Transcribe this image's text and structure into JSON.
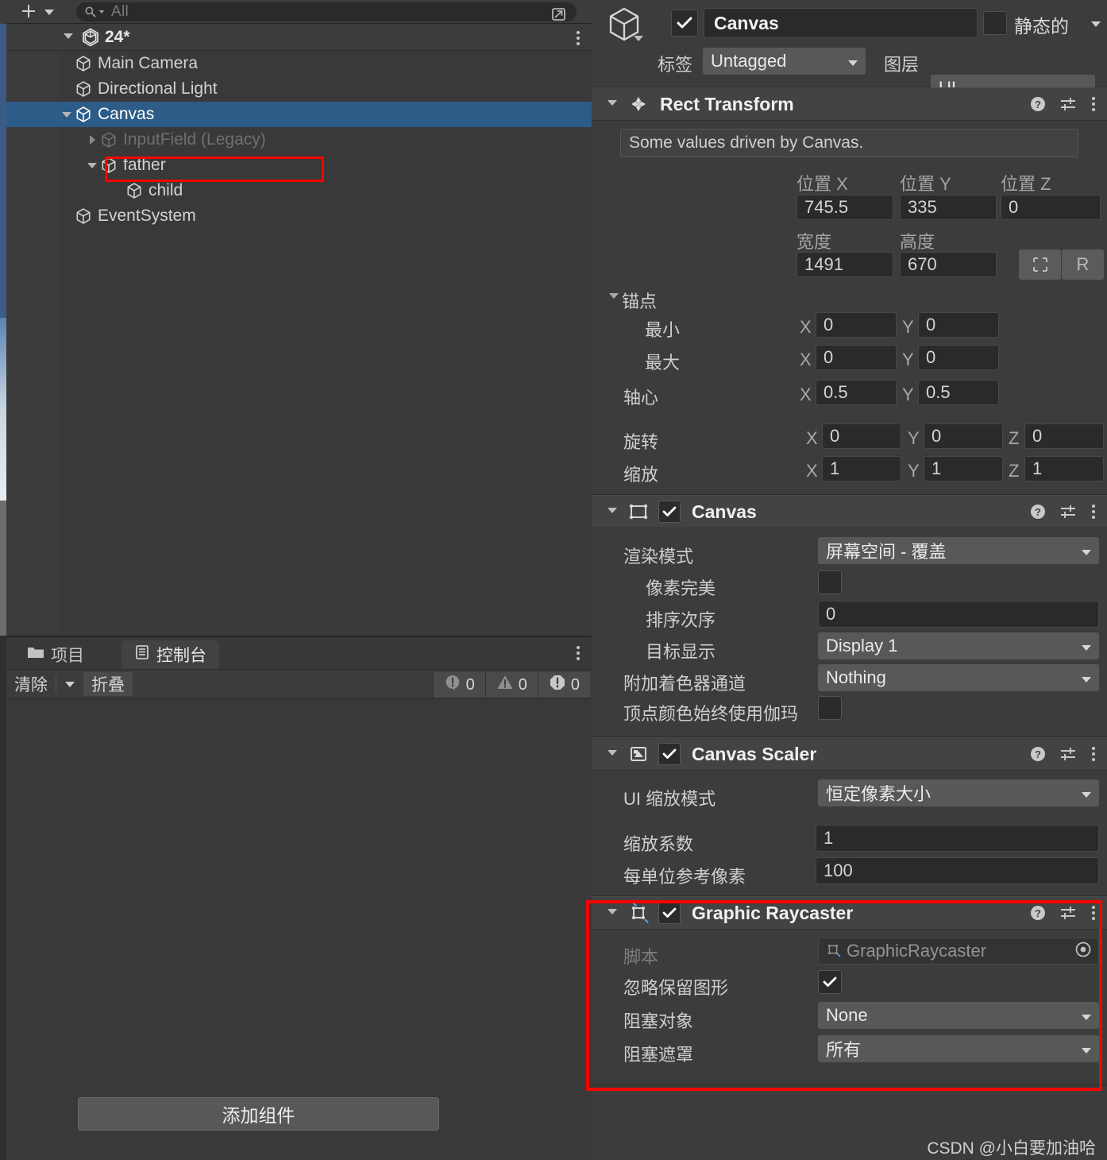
{
  "hierarchy": {
    "toolbar": {
      "add_button": "+",
      "add_caret_icon": "chevron-down-icon",
      "search_icon": "search-icon",
      "search_placeholder": "All",
      "search_value": "",
      "expand_icon": "open-in-new-icon"
    },
    "scene": {
      "name": "24*",
      "unity_icon": "unity-logo-icon",
      "expanded": true,
      "kebab_icon": "more-vertical-icon"
    },
    "items": [
      {
        "label": "Main Camera",
        "depth": 1,
        "expander": "none",
        "dim": false,
        "selected": false
      },
      {
        "label": "Directional Light",
        "depth": 1,
        "expander": "none",
        "dim": false,
        "selected": false
      },
      {
        "label": "Canvas",
        "depth": 1,
        "expander": "expanded",
        "dim": false,
        "selected": true
      },
      {
        "label": "InputField (Legacy)",
        "depth": 2,
        "expander": "collapsed",
        "dim": true,
        "selected": false
      },
      {
        "label": "father",
        "depth": 2,
        "expander": "expanded",
        "dim": false,
        "selected": false
      },
      {
        "label": "child",
        "depth": 3,
        "expander": "none",
        "dim": false,
        "selected": false
      },
      {
        "label": "EventSystem",
        "depth": 1,
        "expander": "none",
        "dim": false,
        "selected": false
      }
    ]
  },
  "bottom_panel": {
    "tabs": [
      {
        "label": "项目",
        "icon": "folder-icon",
        "active": false
      },
      {
        "label": "控制台",
        "icon": "console-icon",
        "active": true
      }
    ],
    "kebab_icon": "more-vertical-icon",
    "console_toolbar": {
      "clear_label": "清除",
      "clear_caret_icon": "chevron-down-icon",
      "collapse_label": "折叠",
      "counters": [
        {
          "icon": "info-icon",
          "count": "0"
        },
        {
          "icon": "warning-icon",
          "count": "0"
        },
        {
          "icon": "error-icon",
          "count": "0"
        }
      ]
    }
  },
  "inspector": {
    "header": {
      "gameobject_icon": "cube-icon",
      "dropdown_caret_icon": "chevron-down-icon",
      "enabled_checkbox": true,
      "name_value": "Canvas",
      "static_checkbox": false,
      "static_label": "静态的",
      "static_caret_icon": "chevron-down-icon",
      "tag_label": "标签",
      "tag_value": "Untagged",
      "layer_label": "图层",
      "layer_value": "UI"
    },
    "rect_transform": {
      "title": "Rect Transform",
      "icon": "rect-transform-icon",
      "help_icon": "help-icon",
      "preset_icon": "preset-icon",
      "kebab_icon": "more-vertical-icon",
      "info_text": "Some values driven by Canvas.",
      "pos_x_label": "位置 X",
      "pos_y_label": "位置 Y",
      "pos_z_label": "位置 Z",
      "pos_x_value": "745.5",
      "pos_y_value": "335",
      "pos_z_value": "0",
      "width_label": "宽度",
      "height_label": "高度",
      "width_value": "1491",
      "height_value": "670",
      "blueprint_icon": "blueprint-icon",
      "raw_label": "R",
      "anchors_label": "锚点",
      "min_label": "最小",
      "max_label": "最大",
      "pivot_label": "轴心",
      "anchor_min_x": "0",
      "anchor_min_y": "0",
      "anchor_max_x": "0",
      "anchor_max_y": "0",
      "pivot_x": "0.5",
      "pivot_y": "0.5",
      "rotation_label": "旋转",
      "rot_x": "0",
      "rot_y": "0",
      "rot_z": "0",
      "scale_label": "缩放",
      "scale_x": "1",
      "scale_y": "1",
      "scale_z": "1",
      "axis_x": "X",
      "axis_y": "Y",
      "axis_z": "Z"
    },
    "canvas": {
      "title": "Canvas",
      "icon": "canvas-icon",
      "enabled": true,
      "render_mode_label": "渲染模式",
      "render_mode_value": "屏幕空间 - 覆盖",
      "pixel_perfect_label": "像素完美",
      "pixel_perfect_checked": false,
      "sort_order_label": "排序次序",
      "sort_order_value": "0",
      "target_display_label": "目标显示",
      "target_display_value": "Display 1",
      "shader_channels_label": "附加着色器通道",
      "shader_channels_value": "Nothing",
      "vertex_gamma_label": "顶点颜色始终使用伽玛",
      "vertex_gamma_checked": false
    },
    "canvas_scaler": {
      "title": "Canvas Scaler",
      "icon": "canvas-scaler-icon",
      "enabled": true,
      "ui_scale_mode_label": "UI 缩放模式",
      "ui_scale_mode_value": "恒定像素大小",
      "scale_factor_label": "缩放系数",
      "scale_factor_value": "1",
      "ref_ppu_label": "每单位参考像素",
      "ref_ppu_value": "100"
    },
    "graphic_raycaster": {
      "title": "Graphic Raycaster",
      "icon": "graphic-raycaster-icon",
      "enabled": true,
      "highlighted": true,
      "highlight_color": "#fe0000",
      "script_label": "脚本",
      "script_value": "GraphicRaycaster",
      "script_picker_icon": "object-picker-icon",
      "ignore_reversed_label": "忽略保留图形",
      "ignore_reversed_checked": true,
      "blocking_objects_label": "阻塞对象",
      "blocking_objects_value": "None",
      "blocking_mask_label": "阻塞遮罩",
      "blocking_mask_value": "所有"
    },
    "add_component_label": "添加组件"
  },
  "watermark": "CSDN @小白要加油哈"
}
